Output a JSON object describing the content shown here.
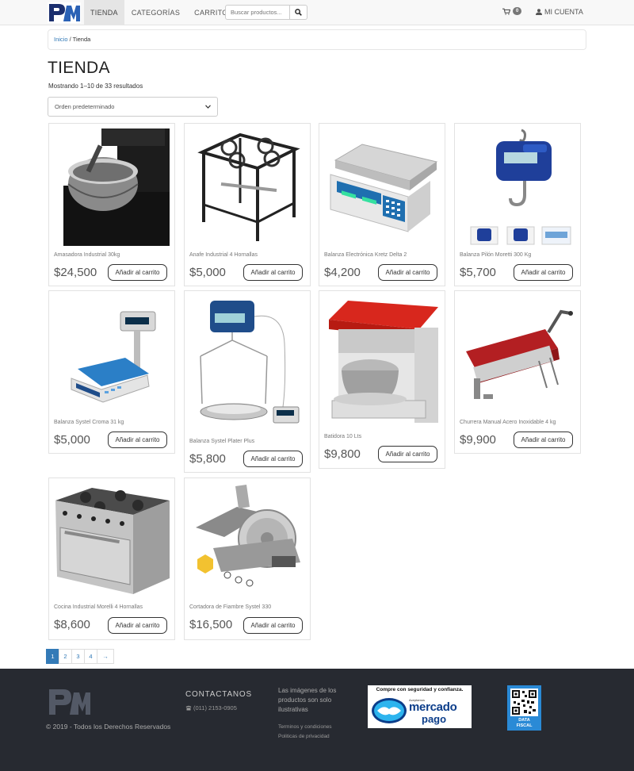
{
  "nav": {
    "items": [
      "TIENDA",
      "CATEGORÍAS",
      "CARRITO"
    ],
    "search_placeholder": "Buscar productos...",
    "cart_count": "0",
    "account_label": "MI CUENTA"
  },
  "breadcrumb": {
    "home": "Inicio",
    "separator": " / ",
    "current": "Tienda"
  },
  "page": {
    "title": "TIENDA",
    "result_count": "Mostrando 1–10 de 33 resultados",
    "orderby": "Orden predeterminado"
  },
  "products": [
    {
      "name": "Amasadora Industrial 30kg",
      "price": "$24,500",
      "button": "Añadir al carrito"
    },
    {
      "name": "Anafe Industrial 4 Hornallas",
      "price": "$5,000",
      "button": "Añadir al carrito"
    },
    {
      "name": "Balanza Electrónica Kretz Delta 2",
      "price": "$4,200",
      "button": "Añadir al carrito"
    },
    {
      "name": "Balanza Pilón Moretti 300 Kg",
      "price": "$5,700",
      "button": "Añadir al carrito"
    },
    {
      "name": "Balanza Systel Croma 31 kg",
      "price": "$5,000",
      "button": "Añadir al carrito"
    },
    {
      "name": "Balanza Systel Plater Plus",
      "price": "$5,800",
      "button": "Añadir al carrito"
    },
    {
      "name": "Batidora 10 Lts",
      "price": "$9,800",
      "button": "Añadir al carrito"
    },
    {
      "name": "Churrera Manual Acero Inoxidable 4 kg",
      "price": "$9,900",
      "button": "Añadir al carrito"
    },
    {
      "name": "Cocina Industrial Morelli 4 Hornallas",
      "price": "$8,600",
      "button": "Añadir al carrito"
    },
    {
      "name": "Cortadora de Fiambre Systel 330",
      "price": "$16,500",
      "button": "Añadir al carrito"
    }
  ],
  "pagination": [
    "1",
    "2",
    "3",
    "4",
    "→"
  ],
  "footer": {
    "copyright": "© 2019 - Todos los Derechos Reservados",
    "contact_title": "CONTACTANOS",
    "phone": "(011) 2153-0905",
    "disclaimer": "Las imágenes de los productos son solo ilustrativas",
    "links": [
      "Terminos y condiciones",
      "Politicas de privacidad"
    ],
    "mp_top": "Compre con seguridad y confianza.",
    "mp_small": "Aceptamos",
    "mp_word1": "mercado",
    "mp_word2": "pago",
    "qr_text1": "DATA",
    "qr_text2": "FISCAL"
  },
  "colors": {
    "brand_blue": "#337ab7",
    "footer_bg": "#272a31",
    "logo_navy": "#1b2f6e"
  }
}
